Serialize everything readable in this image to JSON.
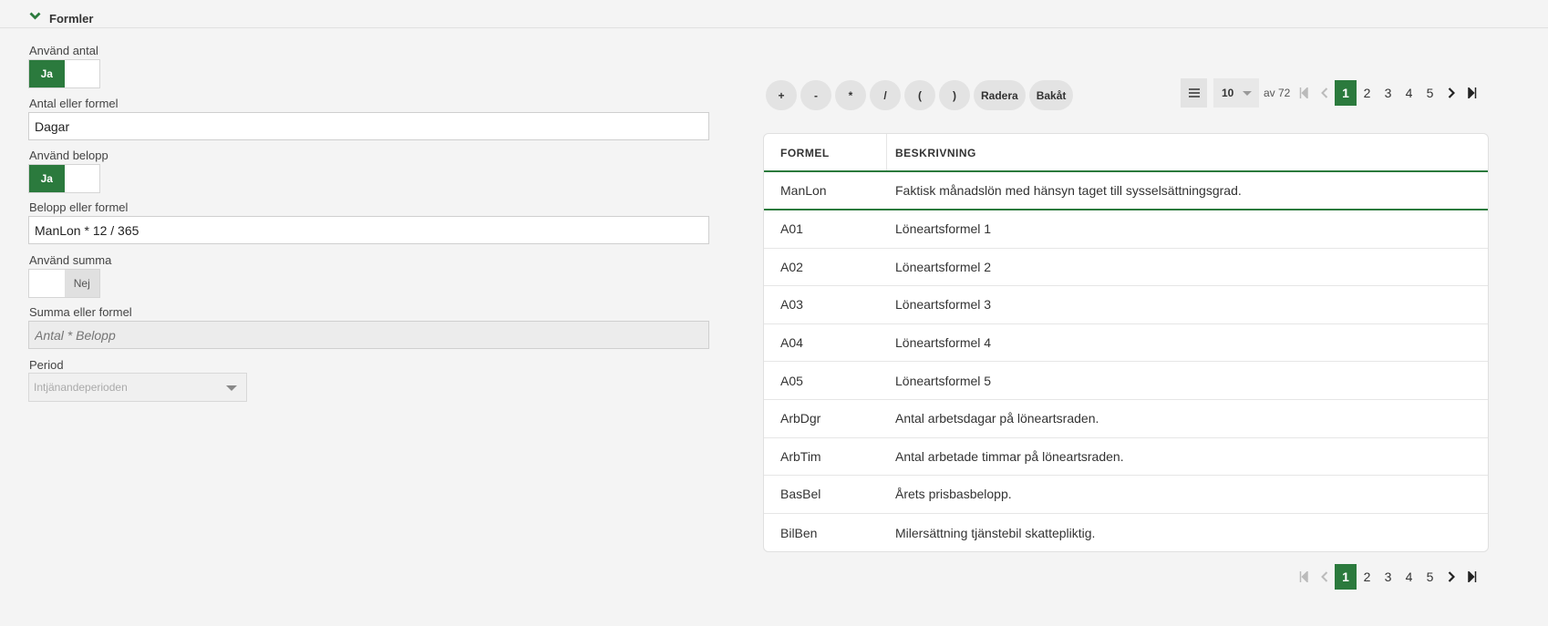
{
  "section": {
    "title": "Formler"
  },
  "form": {
    "use_count": {
      "label": "Använd antal",
      "yes": "Ja",
      "no": "",
      "value": "Ja"
    },
    "count_formula": {
      "label": "Antal eller formel",
      "value": "Dagar"
    },
    "use_amount": {
      "label": "Använd belopp",
      "yes": "Ja",
      "no": "",
      "value": "Ja"
    },
    "amount_formula": {
      "label": "Belopp eller formel",
      "value": "ManLon * 12 / 365"
    },
    "use_sum": {
      "label": "Använd summa",
      "yes": "",
      "no": "Nej",
      "value": "Nej"
    },
    "sum_formula": {
      "label": "Summa eller formel",
      "placeholder": "Antal * Belopp"
    },
    "period": {
      "label": "Period",
      "value": "Intjänandeperioden"
    }
  },
  "calculator": {
    "buttons": [
      "+",
      "-",
      "*",
      "/",
      "(",
      ")",
      "Radera",
      "Bakåt"
    ]
  },
  "pager": {
    "page_size": "10",
    "total_label": "av 72",
    "pages": [
      "1",
      "2",
      "3",
      "4",
      "5"
    ],
    "current": "1"
  },
  "table": {
    "columns": [
      "FORMEL",
      "BESKRIVNING"
    ],
    "rows": [
      {
        "formel": "ManLon",
        "beskrivning": "Faktisk månadslön med hänsyn taget till sysselsättningsgrad."
      },
      {
        "formel": "A01",
        "beskrivning": "Löneartsformel 1"
      },
      {
        "formel": "A02",
        "beskrivning": "Löneartsformel 2"
      },
      {
        "formel": "A03",
        "beskrivning": "Löneartsformel 3"
      },
      {
        "formel": "A04",
        "beskrivning": "Löneartsformel 4"
      },
      {
        "formel": "A05",
        "beskrivning": "Löneartsformel 5"
      },
      {
        "formel": "ArbDgr",
        "beskrivning": "Antal arbetsdagar på löneartsraden."
      },
      {
        "formel": "ArbTim",
        "beskrivning": "Antal arbetade timmar på löneartsraden."
      },
      {
        "formel": "BasBel",
        "beskrivning": "Årets prisbasbelopp."
      },
      {
        "formel": "BilBen",
        "beskrivning": "Milersättning tjänstebil skattepliktig."
      }
    ]
  },
  "colors": {
    "accent": "#2b7a3d"
  }
}
